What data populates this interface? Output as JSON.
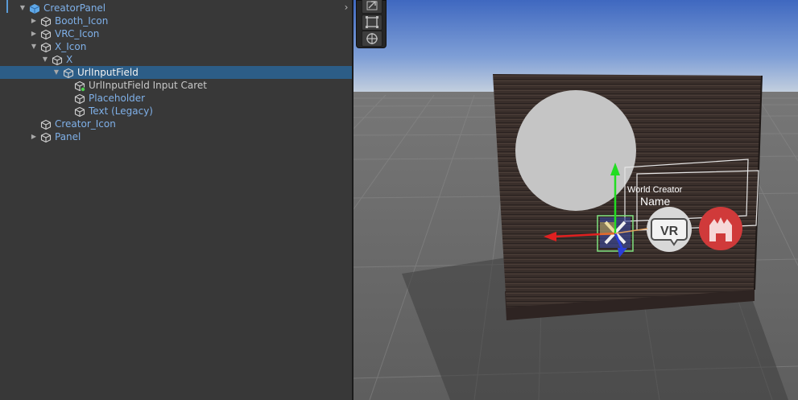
{
  "hierarchy": {
    "items": [
      {
        "label": "CreatorPanel",
        "depth": 0,
        "arrow": "expanded",
        "color": "prefab-root"
      },
      {
        "label": "Booth_Icon",
        "depth": 1,
        "arrow": "collapsed",
        "color": "prefab"
      },
      {
        "label": "VRC_Icon",
        "depth": 1,
        "arrow": "collapsed",
        "color": "prefab"
      },
      {
        "label": "X_Icon",
        "depth": 1,
        "arrow": "expanded",
        "color": "prefab"
      },
      {
        "label": "X",
        "depth": 2,
        "arrow": "expanded",
        "color": "prefab"
      },
      {
        "label": "UrlInputField",
        "depth": 3,
        "arrow": "expanded",
        "color": "prefab",
        "selected": true
      },
      {
        "label": "UrlInputField Input Caret",
        "depth": 4,
        "arrow": "none",
        "color": "plain",
        "added": true
      },
      {
        "label": "Placeholder",
        "depth": 4,
        "arrow": "none",
        "color": "prefab"
      },
      {
        "label": "Text (Legacy)",
        "depth": 4,
        "arrow": "none",
        "color": "prefab"
      },
      {
        "label": "Creator_Icon",
        "depth": 1,
        "arrow": "none",
        "color": "prefab"
      },
      {
        "label": "Panel",
        "depth": 1,
        "arrow": "collapsed",
        "color": "prefab"
      }
    ]
  },
  "scene": {
    "world_label": "World Creator",
    "name_label": "Name",
    "vr_label": "VR",
    "colors": {
      "sky_top": "#4a74c8",
      "sky_horizon": "#c4cfdc",
      "ground": "#6b6b6b",
      "board": "#3c302c",
      "avatar_circle": "#c5c5c5",
      "booth_red": "#d03a3a",
      "gizmo_x": "#e02020",
      "gizmo_y": "#22dd22",
      "gizmo_z": "#2a3ed8"
    }
  },
  "icons": [
    "cube-icon",
    "expand-arrow-icon",
    "collapse-arrow-icon",
    "move-tool-icon",
    "rect-tool-icon",
    "transform-tool-icon"
  ]
}
